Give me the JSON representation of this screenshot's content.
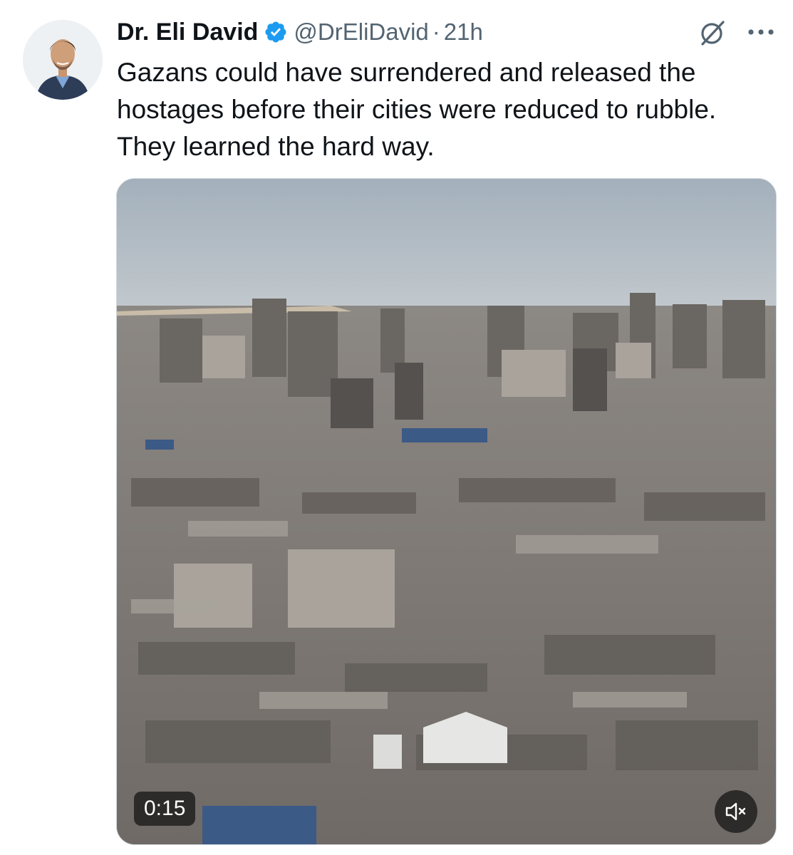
{
  "tweet": {
    "author": {
      "display_name": "Dr. Eli David",
      "handle": "@DrEliDavid",
      "verified": true
    },
    "separator": "·",
    "timestamp": "21h",
    "text": "Gazans could have surrendered and released the hostages before their cities were reduced to rubble. They learned the hard way.",
    "media": {
      "type": "video",
      "duration": "0:15",
      "muted": true
    }
  },
  "icons": {
    "verified": "verified-badge-icon",
    "grok": "grok-icon",
    "more": "more-icon",
    "mute": "volume-muted-icon"
  },
  "colors": {
    "verified_blue": "#1d9bf0",
    "text_primary": "#0f1419",
    "text_secondary": "#536471"
  }
}
